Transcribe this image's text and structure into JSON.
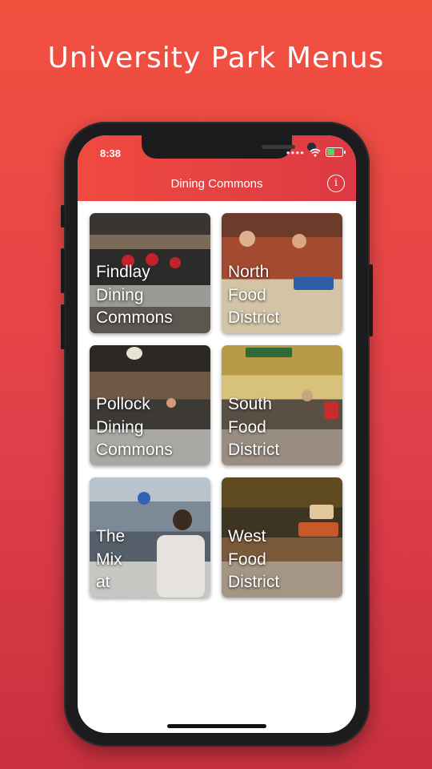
{
  "headline": "University Park Menus",
  "status_bar": {
    "time": "8:38",
    "icons": [
      "signal-icon",
      "wifi-icon",
      "battery-charging-icon"
    ]
  },
  "nav": {
    "title": "Dining Commons",
    "info_icon": "i"
  },
  "tiles": [
    {
      "label": "Findlay\nDining\nCommons",
      "scene": "dining-counter-photo"
    },
    {
      "label": "North\nFood\nDistrict",
      "scene": "snack-counter-photo"
    },
    {
      "label": "Pollock\nDining\nCommons",
      "scene": "dining-hall-photo"
    },
    {
      "label": "South\nFood\nDistrict",
      "scene": "market-photo"
    },
    {
      "label": "The\nMix\nat\nPollock",
      "scene": "cafe-line-photo"
    },
    {
      "label": "West\nFood\nDistrict",
      "scene": "food-court-photo"
    }
  ],
  "colors": {
    "accent": "#e8453f",
    "background_gradient": [
      "#f2503f",
      "#c8303e"
    ]
  }
}
